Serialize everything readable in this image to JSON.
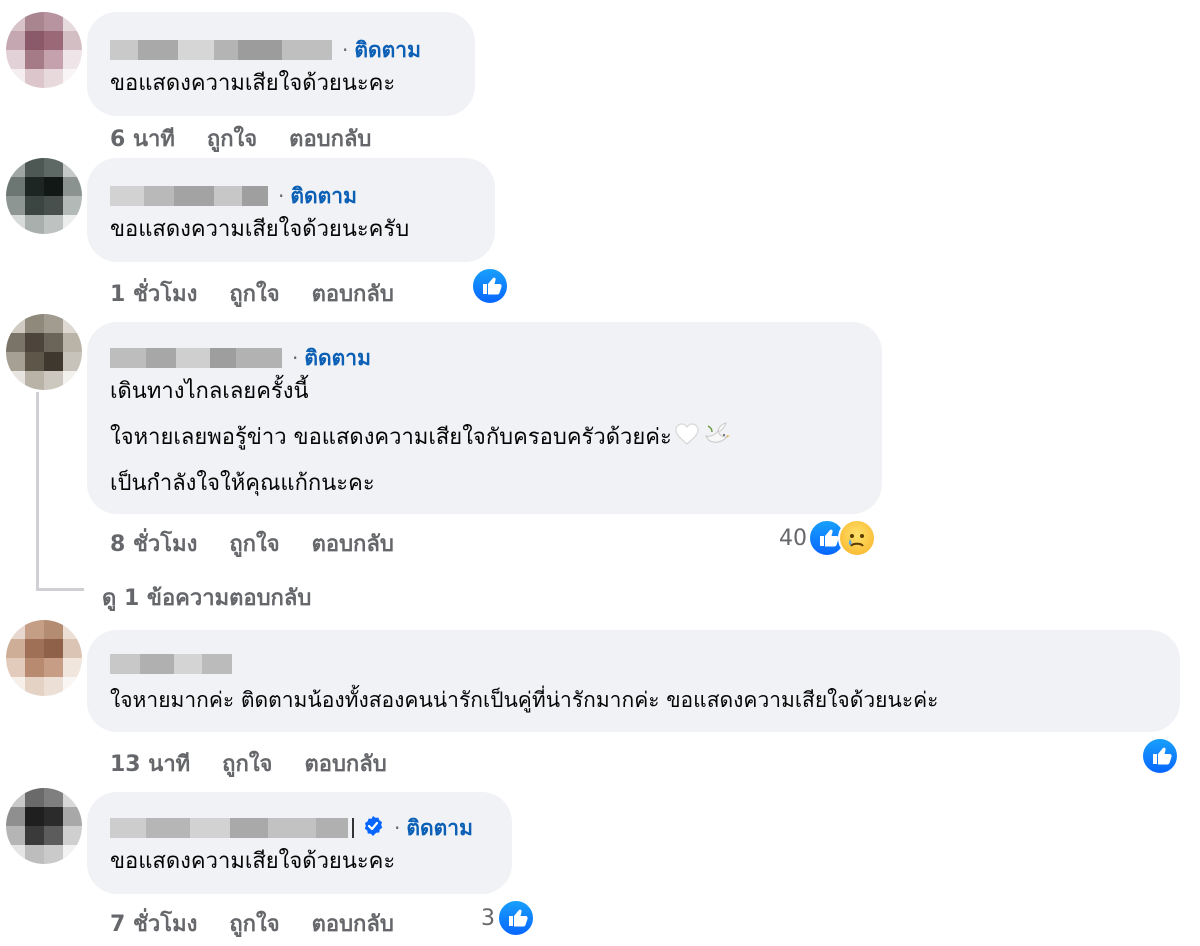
{
  "colors": {
    "bubble": "#f0f2f5",
    "follow": "#0b5fb5",
    "meta": "#65676b",
    "like": "#0866ff"
  },
  "comments": [
    {
      "follow_label": "ติดตาม",
      "text_lines": [
        "ขอแสดงความเสียใจด้วยนะคะ"
      ],
      "time": "6 นาที",
      "like_label": "ถูกใจ",
      "reply_label": "ตอบกลับ"
    },
    {
      "follow_label": "ติดตาม",
      "text_lines": [
        "ขอแสดงความเสียใจด้วยนะครับ"
      ],
      "time": "1 ชั่วโมง",
      "like_label": "ถูกใจ",
      "reply_label": "ตอบกลับ",
      "reaction_icon": "like-icon"
    },
    {
      "follow_label": "ติดตาม",
      "text_lines": [
        "เดินทางไกลเลยครั้งนี้",
        "ใจหายเลยพอรู้ข่าว ขอแสดงความเสียใจกับครอบครัวด้วยค่ะ",
        "เป็นกำลังใจให้คุณแก้กนะคะ"
      ],
      "emoji": [
        "white-heart-icon",
        "dove-icon"
      ],
      "time": "8 ชั่วโมง",
      "like_label": "ถูกใจ",
      "reply_label": "ตอบกลับ",
      "reaction_count": "40",
      "reaction_icons": [
        "like-icon",
        "sad-icon"
      ],
      "view_replies": "ดู 1 ข้อความตอบกลับ"
    },
    {
      "text_lines": [
        "ใจหายมากค่ะ ติดตามน้องทั้งสองคนน่ารักเป็นคู่ที่น่ารักมากค่ะ ขอแสดงความเสียใจด้วยนะค่ะ"
      ],
      "time": "13 นาที",
      "like_label": "ถูกใจ",
      "reply_label": "ตอบกลับ",
      "reaction_icon": "like-icon"
    },
    {
      "follow_label": "ติดตาม",
      "verified_icon": "verified-badge-icon",
      "text_lines": [
        "ขอแสดงความเสียใจด้วยนะคะ"
      ],
      "time": "7 ชั่วโมง",
      "like_label": "ถูกใจ",
      "reply_label": "ตอบกลับ",
      "reaction_count": "3",
      "reaction_icons": [
        "like-icon"
      ]
    }
  ]
}
